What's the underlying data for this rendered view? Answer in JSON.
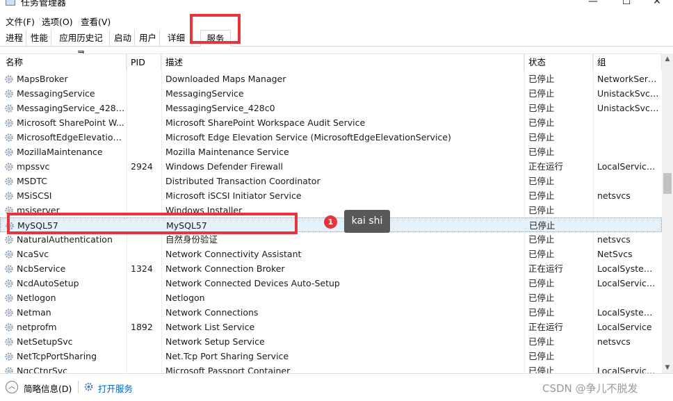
{
  "window": {
    "title": "任务管理器",
    "controls": [
      "—",
      "☐",
      "✕"
    ]
  },
  "menu": [
    "文件(F)",
    "选项(O)",
    "查看(V)"
  ],
  "tabs": [
    "进程",
    "性能",
    "应用历史记录",
    "启动",
    "用户",
    "详细信息",
    "服务"
  ],
  "active_tab": "服务",
  "columns": {
    "name": "名称",
    "pid": "PID",
    "desc": "描述",
    "status": "状态",
    "group": "组"
  },
  "rows": [
    {
      "name": "MapsBroker",
      "pid": "",
      "desc": "Downloaded Maps Manager",
      "status": "已停止",
      "group": "NetworkServ..."
    },
    {
      "name": "MessagingService",
      "pid": "",
      "desc": "MessagingService",
      "status": "已停止",
      "group": "UnistackSvcG..."
    },
    {
      "name": "MessagingService_428c0",
      "pid": "",
      "desc": "MessagingService_428c0",
      "status": "已停止",
      "group": "UnistackSvcG..."
    },
    {
      "name": "Microsoft SharePoint W...",
      "pid": "",
      "desc": "Microsoft SharePoint Workspace Audit Service",
      "status": "已停止",
      "group": ""
    },
    {
      "name": "MicrosoftEdgeElevationS...",
      "pid": "",
      "desc": "Microsoft Edge Elevation Service (MicrosoftEdgeElevationService)",
      "status": "已停止",
      "group": ""
    },
    {
      "name": "MozillaMaintenance",
      "pid": "",
      "desc": "Mozilla Maintenance Service",
      "status": "已停止",
      "group": ""
    },
    {
      "name": "mpssvc",
      "pid": "2924",
      "desc": "Windows Defender Firewall",
      "status": "正在运行",
      "group": "LocalService..."
    },
    {
      "name": "MSDTC",
      "pid": "",
      "desc": "Distributed Transaction Coordinator",
      "status": "已停止",
      "group": ""
    },
    {
      "name": "MSiSCSI",
      "pid": "",
      "desc": "Microsoft iSCSI Initiator Service",
      "status": "已停止",
      "group": "netsvcs"
    },
    {
      "name": "msiserver",
      "pid": "",
      "desc": "Windows Installer",
      "status": "已停止",
      "group": ""
    },
    {
      "name": "MySQL57",
      "pid": "",
      "desc": "MySQL57",
      "status": "已停止",
      "group": ""
    },
    {
      "name": "NaturalAuthentication",
      "pid": "",
      "desc": "自然身份验证",
      "status": "已停止",
      "group": "netsvcs"
    },
    {
      "name": "NcaSvc",
      "pid": "",
      "desc": "Network Connectivity Assistant",
      "status": "已停止",
      "group": "NetSvcs"
    },
    {
      "name": "NcbService",
      "pid": "1324",
      "desc": "Network Connection Broker",
      "status": "正在运行",
      "group": "LocalSystem..."
    },
    {
      "name": "NcdAutoSetup",
      "pid": "",
      "desc": "Network Connected Devices Auto-Setup",
      "status": "已停止",
      "group": "LocalService..."
    },
    {
      "name": "Netlogon",
      "pid": "",
      "desc": "Netlogon",
      "status": "已停止",
      "group": ""
    },
    {
      "name": "Netman",
      "pid": "",
      "desc": "Network Connections",
      "status": "已停止",
      "group": "LocalSystem..."
    },
    {
      "name": "netprofm",
      "pid": "1892",
      "desc": "Network List Service",
      "status": "正在运行",
      "group": "LocalService"
    },
    {
      "name": "NetSetupSvc",
      "pid": "",
      "desc": "Network Setup Service",
      "status": "已停止",
      "group": "netsvcs"
    },
    {
      "name": "NetTcpPortSharing",
      "pid": "",
      "desc": "Net.Tcp Port Sharing Service",
      "status": "已停止",
      "group": ""
    },
    {
      "name": "NgcCtnrSvc",
      "pid": "",
      "desc": "Microsoft Passport Container",
      "status": "已停止",
      "group": "LocalService..."
    }
  ],
  "selected_row_name": "MySQL57",
  "footer": {
    "less_details": "简略信息(D)",
    "open_services": "打开服务",
    "watermark": "CSDN @争儿不脱发"
  },
  "annotation": {
    "badge": "1",
    "tooltip": "kai shi"
  },
  "accent_colors": {
    "highlight_box": "#e8353b",
    "link": "#0066cc",
    "selected_row": "#e5f1fb"
  }
}
